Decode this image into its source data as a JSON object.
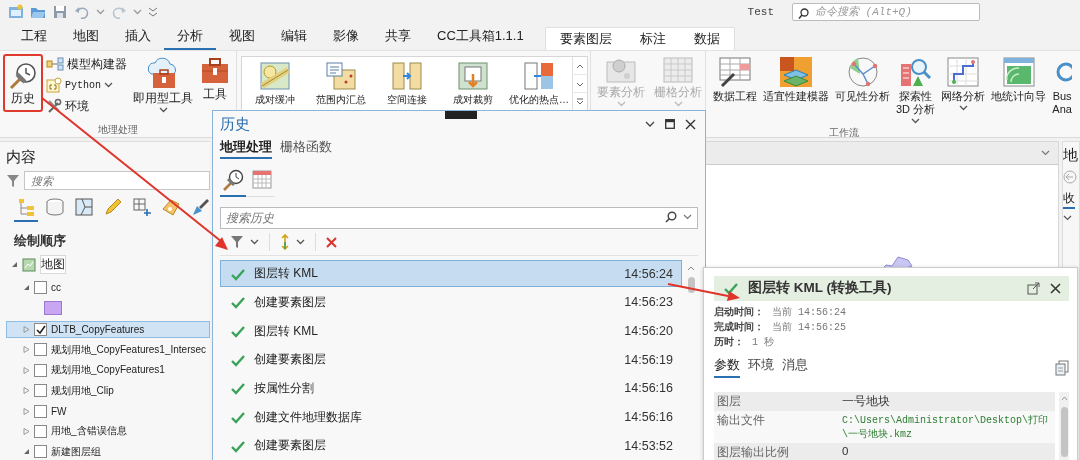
{
  "quick_access": {
    "label": "Test",
    "search": {
      "placeholder": "命令搜索 (Alt+Q)"
    }
  },
  "tabs": [
    {
      "label": "工程",
      "selected": false
    },
    {
      "label": "地图",
      "selected": false
    },
    {
      "label": "插入",
      "selected": false
    },
    {
      "label": "分析",
      "selected": true
    },
    {
      "label": "视图",
      "selected": false
    },
    {
      "label": "编辑",
      "selected": false
    },
    {
      "label": "影像",
      "selected": false
    },
    {
      "label": "共享",
      "selected": false
    },
    {
      "label": "CC工具箱1.1.1",
      "selected": false
    }
  ],
  "context_tabs": [
    {
      "label": "要素图层"
    },
    {
      "label": "标注"
    },
    {
      "label": "数据"
    }
  ],
  "ribbon": {
    "geoprocessing": {
      "history": {
        "label": "历史",
        "highlighted": true
      },
      "small_tools": [
        {
          "label": "模型构建器",
          "kind": "model",
          "dropdown": false
        },
        {
          "label": "Python",
          "kind": "python",
          "dropdown": true
        },
        {
          "label": "环境",
          "kind": "environment",
          "dropdown": false
        }
      ],
      "big_tools": [
        {
          "label": "即用型工具",
          "kind": "cloud",
          "dropdown": true
        },
        {
          "label": "工具",
          "kind": "toolbox",
          "dropdown": false
        }
      ],
      "group_label": "地理处理"
    },
    "gallery": [
      {
        "label": "成对缓冲",
        "kind": "buffer"
      },
      {
        "label": "范围内汇总",
        "kind": "summarize"
      },
      {
        "label": "空间连接",
        "kind": "join"
      },
      {
        "label": "成对裁剪",
        "kind": "clip"
      },
      {
        "label": "优化的热点…",
        "kind": "hotspot"
      }
    ],
    "analysis": [
      {
        "label": "要素分析",
        "kind": "feature",
        "disabled": true
      },
      {
        "label": "栅格分析",
        "kind": "raster",
        "disabled": true
      }
    ],
    "workflows": {
      "items": [
        {
          "label": "数据工程",
          "kind": "data",
          "dropdown": false
        },
        {
          "label": "适宜性建模器",
          "kind": "suitability",
          "dropdown": false
        },
        {
          "label": "可见性分析",
          "kind": "visibility",
          "dropdown": false
        },
        {
          "label": "探索性\n3D 分析",
          "kind": "explore3d",
          "dropdown": true
        },
        {
          "label": "网络分析",
          "kind": "network",
          "dropdown": true
        },
        {
          "label": "地统计向导",
          "kind": "geostat",
          "dropdown": false
        },
        {
          "label": "Bus\nAna",
          "kind": "business",
          "dropdown": false
        }
      ],
      "group_label": "工作流"
    }
  },
  "contents": {
    "title": "内容",
    "search": {
      "placeholder": "搜索"
    },
    "views": [
      {
        "kind": "drawing-order",
        "selected": true
      },
      {
        "kind": "source",
        "selected": false
      },
      {
        "kind": "selection",
        "selected": false
      },
      {
        "kind": "editing",
        "selected": false
      },
      {
        "kind": "snapping",
        "selected": false
      },
      {
        "kind": "labeling",
        "selected": false
      },
      {
        "kind": "symbology",
        "selected": false
      }
    ],
    "heading": "绘制顺序",
    "tree": [
      {
        "label": "地图",
        "kind": "map",
        "expanded": true,
        "selected": false,
        "children": [
          {
            "label": "cc",
            "kind": "layer",
            "expanded": true,
            "checked": false,
            "selected": false,
            "swatch": {
              "color": "#c8a6f2"
            }
          },
          {
            "label": "DLTB_CopyFeatures",
            "kind": "layer",
            "expanded": false,
            "checked": true,
            "selected": true
          },
          {
            "label": "规划用地_CopyFeatures1_Intersec",
            "kind": "layer",
            "expanded": false,
            "checked": false,
            "selected": false
          },
          {
            "label": "规划用地_CopyFeatures1",
            "kind": "layer",
            "expanded": false,
            "checked": false,
            "selected": false
          },
          {
            "label": "规划用地_Clip",
            "kind": "layer",
            "expanded": false,
            "checked": false,
            "selected": false
          },
          {
            "label": "FW",
            "kind": "layer",
            "expanded": false,
            "checked": false,
            "selected": false
          },
          {
            "label": "用地_含错误信息",
            "kind": "layer",
            "expanded": false,
            "checked": false,
            "selected": false
          },
          {
            "label": "新建图层组",
            "kind": "layer",
            "expanded": true,
            "checked": false,
            "selected": false
          }
        ]
      }
    ]
  },
  "history": {
    "title": "历史",
    "tabs": [
      {
        "label": "地理处理",
        "selected": true
      },
      {
        "label": "栅格函数",
        "selected": false
      }
    ],
    "views": [
      {
        "kind": "history",
        "selected": true
      },
      {
        "kind": "calendar",
        "selected": false
      }
    ],
    "search": {
      "placeholder": "搜索历史"
    },
    "entries": [
      {
        "name": "图层转 KML",
        "time": "14:56:24",
        "succeeded": true,
        "selected": true
      },
      {
        "name": "创建要素图层",
        "time": "14:56:23",
        "succeeded": true,
        "selected": false
      },
      {
        "name": "图层转 KML",
        "time": "14:56:20",
        "succeeded": true,
        "selected": false
      },
      {
        "name": "创建要素图层",
        "time": "14:56:19",
        "succeeded": true,
        "selected": false
      },
      {
        "name": "按属性分割",
        "time": "14:56:16",
        "succeeded": true,
        "selected": false
      },
      {
        "name": "创建文件地理数据库",
        "time": "14:56:16",
        "succeeded": true,
        "selected": false
      },
      {
        "name": "创建要素图层",
        "time": "14:53:52",
        "succeeded": true,
        "selected": false
      }
    ]
  },
  "detail": {
    "title": "图层转 KML (转换工具)",
    "succeeded": true,
    "info": [
      {
        "label": "启动时间：",
        "value": "当前 14:56:24"
      },
      {
        "label": "完成时间：",
        "value": "当前 14:56:25"
      },
      {
        "label": "历时：",
        "value": "1 秒"
      }
    ],
    "tabs": [
      {
        "label": "参数",
        "selected": true
      },
      {
        "label": "环境",
        "selected": false
      },
      {
        "label": "消息",
        "selected": false
      }
    ],
    "parameters": [
      {
        "name": "图层",
        "value": "一号地块",
        "kind": "text"
      },
      {
        "name": "输出文件",
        "value": "C:\\Users\\Administrator\\Desktop\\打印\\一号地块.kmz",
        "kind": "path"
      },
      {
        "name": "图层输出比例",
        "value": "0",
        "kind": "text"
      }
    ]
  },
  "right_pane": {
    "title": "地",
    "tab": "收"
  }
}
